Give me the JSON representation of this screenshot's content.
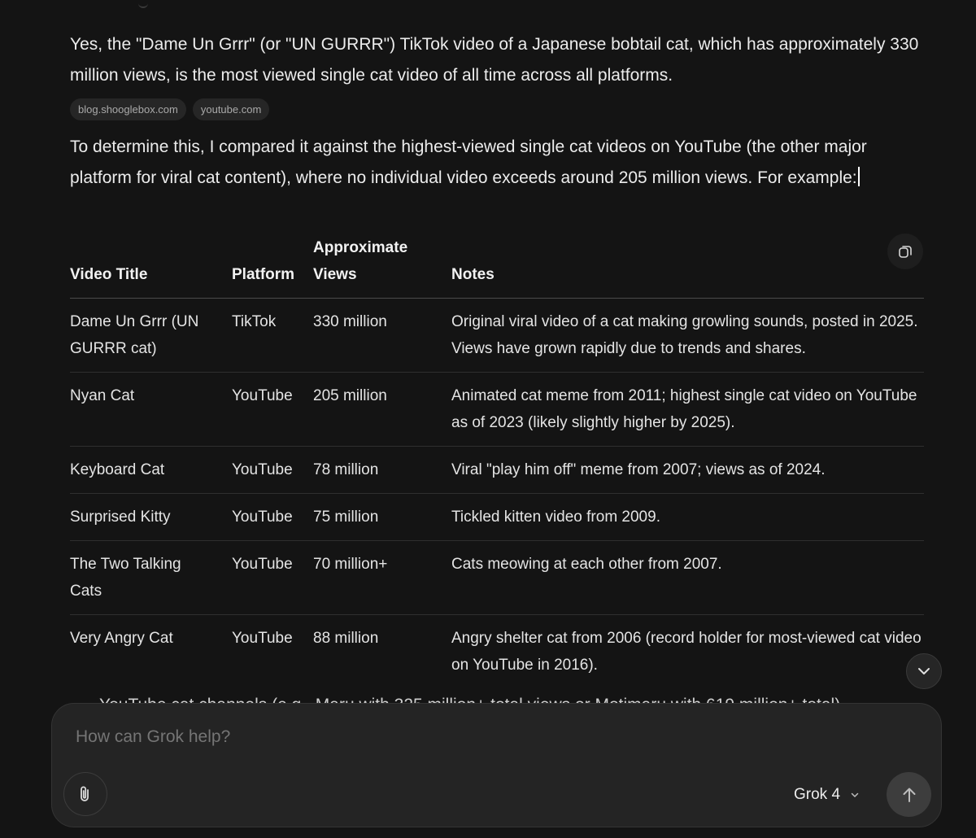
{
  "message": {
    "paragraph1": "Yes, the \"Dame Un Grrr\" (or \"UN GURRR\") TikTok video of a Japanese bobtail cat, which has approximately 330 million views, is the most viewed single cat video of all time across all platforms.",
    "sources": [
      "blog.shooglebox.com",
      "youtube.com"
    ],
    "paragraph2": "To determine this, I compared it against the highest-viewed single cat videos on YouTube (the other major platform for viral cat content), where no individual video exceeds around 205 million views. For example:",
    "table": {
      "headers": [
        "Video Title",
        "Platform",
        "Approximate Views",
        "Notes"
      ],
      "rows": [
        {
          "title": "Dame Un Grrr (UN GURRR cat)",
          "platform": "TikTok",
          "views": "330 million",
          "notes": "Original viral video of a cat making growling sounds, posted in 2025. Views have grown rapidly due to trends and shares."
        },
        {
          "title": "Nyan Cat",
          "platform": "YouTube",
          "views": "205 million",
          "notes": "Animated cat meme from 2011; highest single cat video on YouTube as of 2023 (likely slightly higher by 2025)."
        },
        {
          "title": "Keyboard Cat",
          "platform": "YouTube",
          "views": "78 million",
          "notes": "Viral \"play him off\" meme from 2007; views as of 2024."
        },
        {
          "title": "Surprised Kitty",
          "platform": "YouTube",
          "views": "75 million",
          "notes": "Tickled kitten video from 2009."
        },
        {
          "title": "The Two Talking Cats",
          "platform": "YouTube",
          "views": "70 million+",
          "notes": "Cats meowing at each other from 2007."
        },
        {
          "title": "Very Angry Cat",
          "platform": "YouTube",
          "views": "88 million",
          "notes": "Angry shelter cat from 2006 (record holder for most-viewed cat video on YouTube in 2016)."
        }
      ]
    },
    "partial_bullet": "YouTube cat channels (e.g., Maru with 325 million+ total views or Motimaru with 619 million+ total)"
  },
  "icons": {
    "copy": "copy-icon",
    "scroll": "chevron-down-icon",
    "attach": "paperclip-icon",
    "model_caret": "chevron-down-icon",
    "send": "arrow-up-icon"
  },
  "composer": {
    "placeholder": "How can Grok help?",
    "model": "Grok 4"
  }
}
